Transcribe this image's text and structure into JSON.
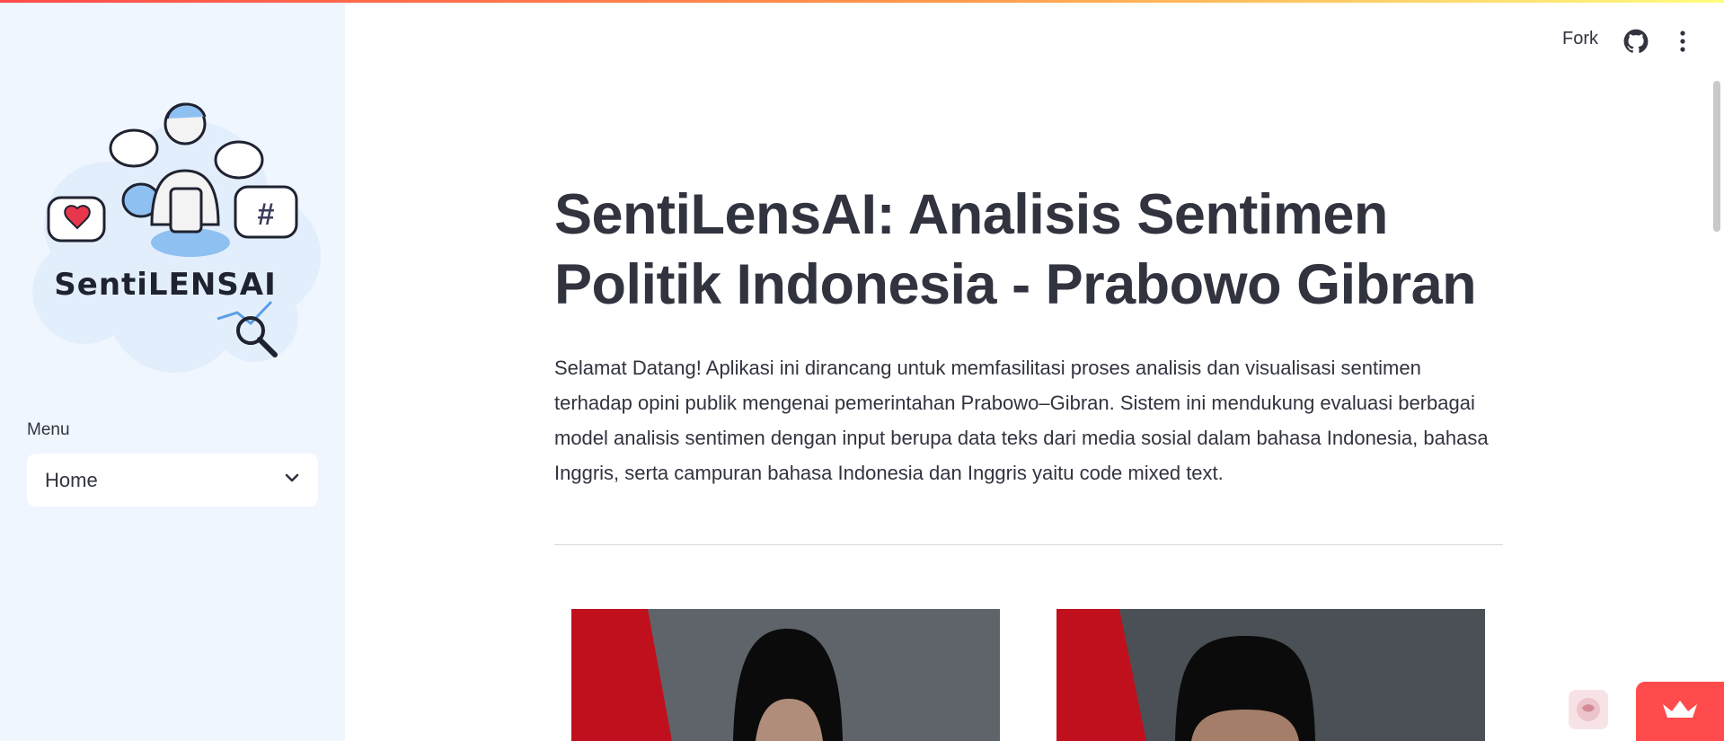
{
  "sidebar": {
    "logo_text": "SentiLENSAI",
    "menu_label": "Menu",
    "menu_selected": "Home"
  },
  "header": {
    "fork_label": "Fork",
    "icons": [
      "github-icon",
      "more-vertical-icon"
    ]
  },
  "main": {
    "title": "SentiLensAI: Analisis Sentimen Politik Indonesia - Prabowo Gibran",
    "intro": "Selamat Datang! Aplikasi ini dirancang untuk memfasilitasi proses analisis dan visualisasi sentimen terhadap opini publik mengenai pemerintahan Prabowo–Gibran. Sistem ini mendukung evaluasi berbagai model analisis sentimen dengan input berupa data teks dari media sosial dalam bahasa Indonesia, bahasa Inggris, serta campuran bahasa Indonesia dan Inggris yaitu code mixed text."
  },
  "colors": {
    "accent": "#ff4b4b",
    "sidebar_bg": "#f0f6fe",
    "text": "#31333f",
    "flag_red": "#c0101e"
  }
}
